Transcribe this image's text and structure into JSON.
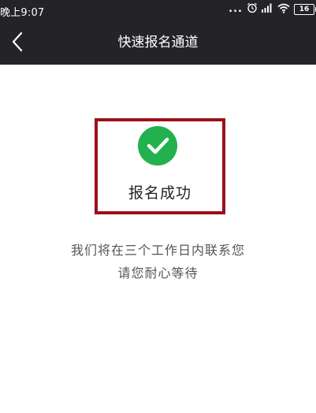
{
  "status_bar": {
    "time": "晚上9:07",
    "dots": "...",
    "battery": "16",
    "icons": [
      "alarm-icon",
      "signal-icon",
      "wifi-icon",
      "battery-icon"
    ]
  },
  "nav": {
    "back_icon": "chevron-left-icon",
    "title": "快速报名通道"
  },
  "result": {
    "icon": "check-circle-icon",
    "title": "报名成功",
    "message_line1": "我们将在三个工作日内联系您",
    "message_line2": "请您耐心等待"
  },
  "colors": {
    "header_bg": "#232328",
    "success_green": "#22b14c",
    "highlight_border": "#9b1018"
  }
}
